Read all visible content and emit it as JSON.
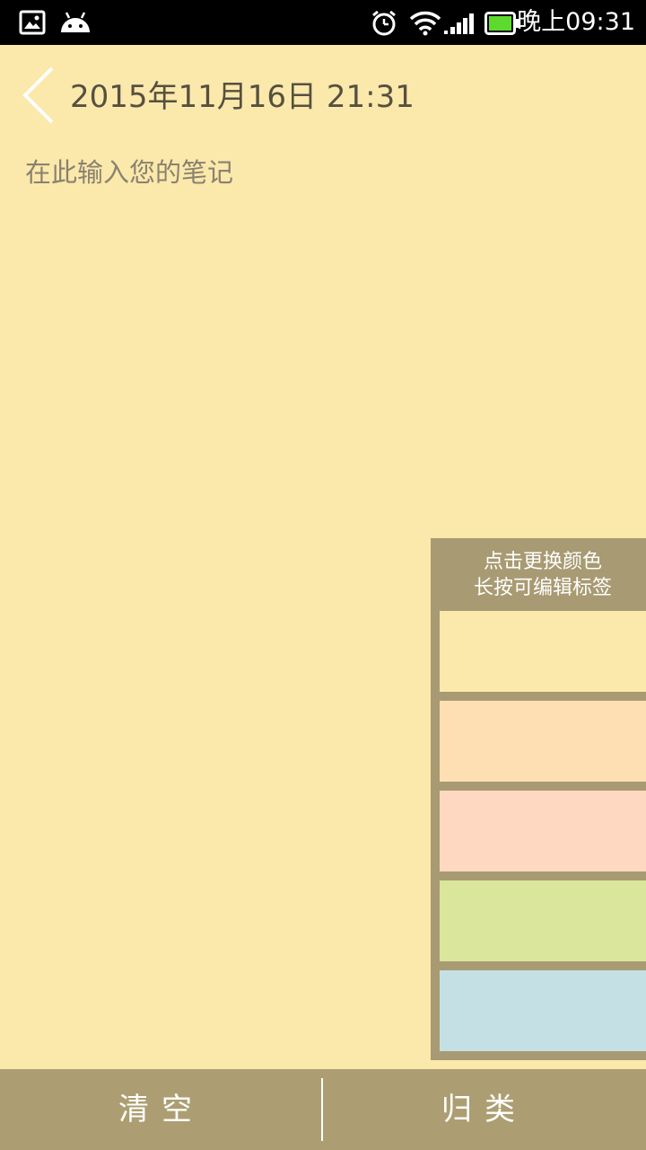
{
  "status_bar": {
    "time": "晚上09:31",
    "icons": [
      "gallery-icon",
      "android-icon",
      "alarm-icon",
      "wifi-icon",
      "signal-icon",
      "battery-icon"
    ],
    "battery_color": "#5DDB2C"
  },
  "header": {
    "date": "2015年11月16日 21:31"
  },
  "note": {
    "value": "",
    "placeholder": "在此输入您的笔记"
  },
  "color_panel": {
    "hint_line1": "点击更换颜色",
    "hint_line2": "长按可编辑标签",
    "swatches": [
      "#FBE8AB",
      "#FDDFB3",
      "#FFD8C2",
      "#DAE69C",
      "#C4E0E4"
    ]
  },
  "bottom_bar": {
    "clear_label": "清空",
    "categorize_label": "归类"
  },
  "colors": {
    "background": "#FBE8AB",
    "bar": "#AC9E72",
    "panel": "#A89A72",
    "text": "#56503F"
  }
}
